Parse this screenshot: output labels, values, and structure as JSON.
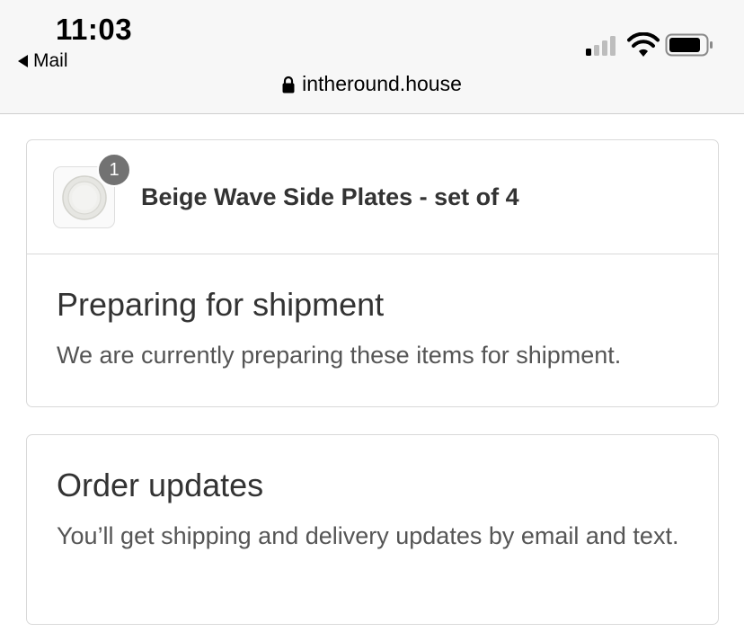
{
  "status_bar": {
    "time": "11:03",
    "back_label": "Mail",
    "url": "intheround.house",
    "signal_bars_active": 1,
    "signal_bars_total": 4
  },
  "order": {
    "product": {
      "name": "Beige Wave Side Plates - set of 4",
      "quantity": "1"
    },
    "status_heading": "Preparing for shipment",
    "status_text": "We are currently preparing these items for shipment."
  },
  "updates": {
    "heading": "Order updates",
    "text": "You’ll get shipping and delivery updates by email and text."
  }
}
